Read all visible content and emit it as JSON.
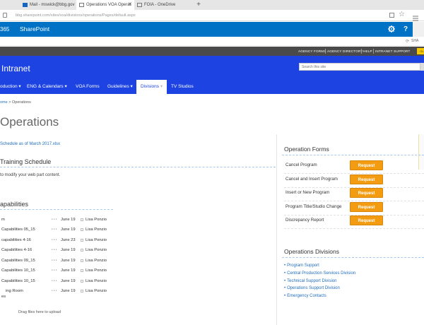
{
  "browser": {
    "tabs": [
      {
        "label": "Mail - mswick@bbg.gov",
        "active": false
      },
      {
        "label": "Operations VOA Operat",
        "active": true
      },
      {
        "label": "FOIA - OneDrive",
        "active": false
      }
    ],
    "new_tab": "+",
    "address_host": "bbg.sharepoint.com",
    "address_prefix": "",
    "address_path": "/sites/voa/divisions/operations/Pages/default.aspx"
  },
  "suite": {
    "app_fragment": "365",
    "app_name": "SharePoint",
    "gear_icon": "gear-icon",
    "help_label": "?"
  },
  "ribbon": {
    "share_label": "SHA"
  },
  "agency_bar": {
    "links": [
      "AGENCY FORMS",
      "AGENCY DIRECTORY",
      "HELP",
      "INTRANET SUPPORT"
    ],
    "extra_label": "GL"
  },
  "header": {
    "site_title": "Intranet",
    "search_placeholder": "Search this site",
    "nav": [
      {
        "label": "oduction",
        "dropdown": true
      },
      {
        "label": "ENG & Calendars",
        "dropdown": true
      },
      {
        "label": "VOA Forms",
        "dropdown": false
      },
      {
        "label": "Guidelines",
        "dropdown": true
      },
      {
        "label": "Divisions",
        "dropdown": true,
        "selected": true
      },
      {
        "label": "TV Studios",
        "dropdown": false
      }
    ]
  },
  "breadcrumb": {
    "home": "ome",
    "sep": " > ",
    "current": "Operations"
  },
  "page_title": "Operations",
  "schedule_link": "Schedule as of March 2017.xlsx",
  "training": {
    "title": "Training Schedule",
    "message": "to modify your web part content."
  },
  "capabilities": {
    "title": "apabilities",
    "rows": [
      {
        "name": "m",
        "date": "June 19",
        "by": "Lisa Ponzio"
      },
      {
        "name": " Capabilities 05_15",
        "date": "June 19",
        "by": "Lisa Ponzio"
      },
      {
        "name": " capabilities 4-16",
        "date": "June 23",
        "by": "Lisa Ponzio"
      },
      {
        "name": " Capabilities 4-16",
        "date": "June 19",
        "by": "Lisa Ponzio"
      },
      {
        "name": " Capabilities 09_15",
        "date": "June 19",
        "by": "Lisa Ponzio"
      },
      {
        "name": " Capabilities 10_15",
        "date": "June 19",
        "by": "Lisa Ponzio"
      },
      {
        "name": " Capabilities 10_15",
        "date": "June 19",
        "by": "Lisa Ponzio"
      },
      {
        "name": "ing Room",
        "name2": "es",
        "date": "June 19",
        "by": "Lisa Ponzio"
      }
    ],
    "more": "···",
    "drag_hint": "Drag files here to upload"
  },
  "operation_forms": {
    "title": "Operation Forms",
    "button_label": "Request",
    "items": [
      "Cancel Program",
      "Cancel and Insert Program",
      "Insert or New Program",
      "Program Title/Studio Change",
      "Discrepancy Report"
    ]
  },
  "operations_divisions": {
    "title": "Operations Divisions",
    "items": [
      "Program Support",
      "Central Production Services Division",
      "Technical Support Division",
      "Operations Support Division",
      "Emergency Contacts"
    ]
  },
  "colors": {
    "suite_blue": "#0072c6",
    "header_blue": "#1d43e3",
    "request_orange": "#f39c12",
    "link_blue": "#1e6dbf"
  }
}
